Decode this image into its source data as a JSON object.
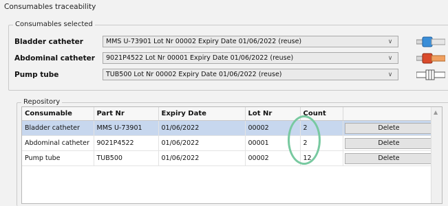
{
  "window": {
    "title": "Consumables traceability"
  },
  "consumables_selected": {
    "label": "Consumables selected",
    "rows": [
      {
        "label": "Bladder catheter",
        "value": "MMS U-73901  Lot Nr 00002  Expiry Date 01/06/2022  (reuse)",
        "icon": "blue-catheter-icon",
        "icon_color": "#3a8ed8"
      },
      {
        "label": "Abdominal catheter",
        "value": "9021P4522  Lot Nr 00001  Expiry Date 01/06/2022  (reuse)",
        "icon": "red-catheter-icon",
        "icon_color": "#d94a2b"
      },
      {
        "label": "Pump tube",
        "value": "TUB500  Lot Nr 00002  Expiry Date 01/06/2022  (reuse)",
        "icon": "pump-tube-icon",
        "icon_color": "#ffffff"
      }
    ]
  },
  "repository": {
    "label": "Repository",
    "columns": [
      "Consumable",
      "Part Nr",
      "Expiry Date",
      "Lot Nr",
      "Count",
      ""
    ],
    "rows": [
      {
        "consumable": "Bladder catheter",
        "part_nr": "MMS U-73901",
        "expiry": "01/06/2022",
        "lot": "00002",
        "count": "2",
        "action": "Delete",
        "selected": true
      },
      {
        "consumable": "Abdominal catheter",
        "part_nr": "9021P4522",
        "expiry": "01/06/2022",
        "lot": "00001",
        "count": "2",
        "action": "Delete",
        "selected": false
      },
      {
        "consumable": "Pump tube",
        "part_nr": "TUB500",
        "expiry": "01/06/2022",
        "lot": "00002",
        "count": "12",
        "action": "Delete",
        "selected": false
      }
    ]
  },
  "colors": {
    "selected_row": "#c7d7ee",
    "highlight": "#78c9a0"
  }
}
